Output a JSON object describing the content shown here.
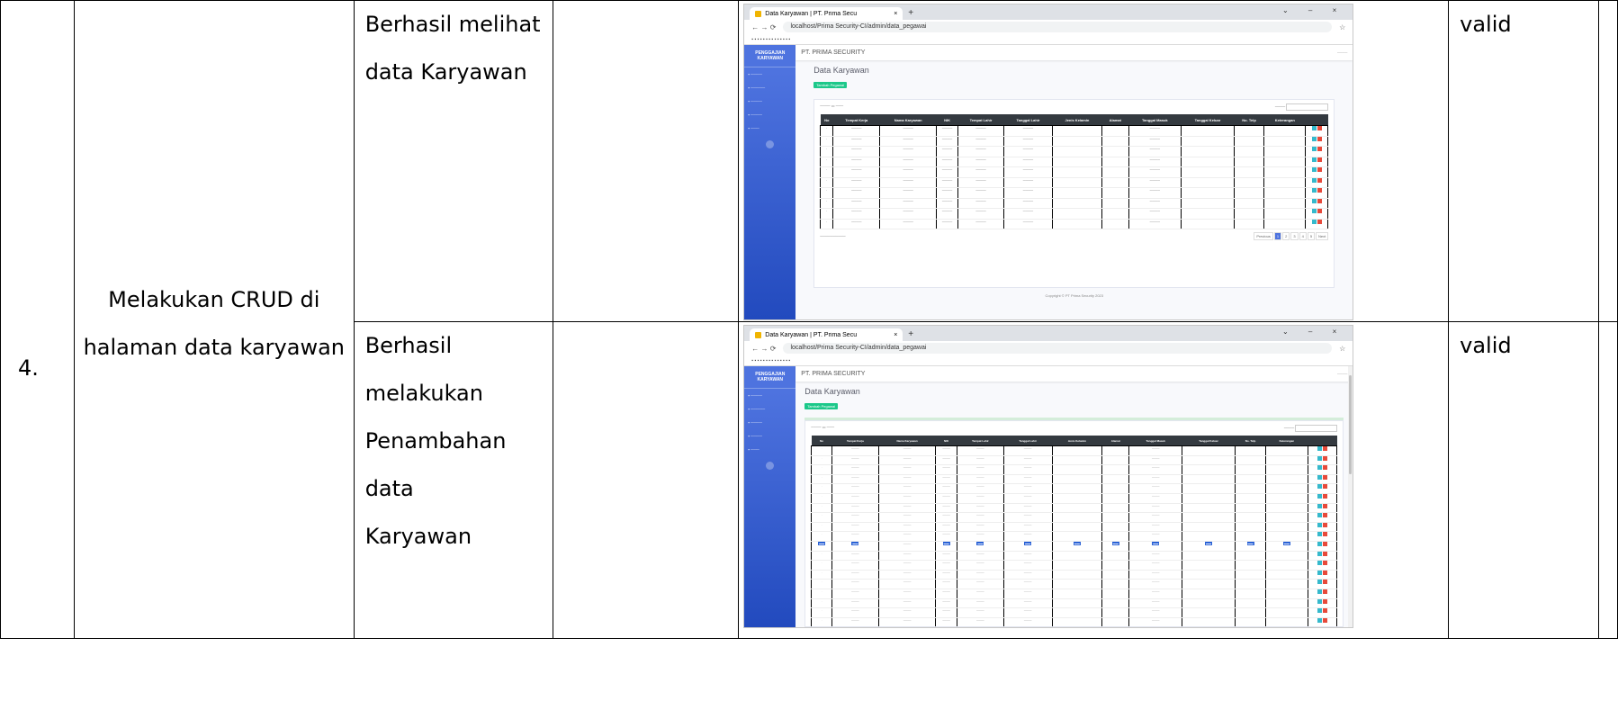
{
  "row_number": "4.",
  "scenario": "Melakukan CRUD di halaman data karyawan",
  "results": [
    {
      "expected": "Berhasil melihat data Karyawan",
      "status": "valid"
    },
    {
      "expected": "Berhasil melakukan Penambahan data Karyawan",
      "status": "valid"
    }
  ],
  "browser": {
    "tab_title": "Data Karyawan | PT. Prima Secu",
    "url": "localhost/Prima Security-CI/admin/data_pegawai"
  },
  "app": {
    "brand": "PENGGAJIAN KARYAWAN",
    "company": "PT. PRIMA SECURITY",
    "page_title": "Data Karyawan",
    "add_button": "Tambah Pegawai",
    "columns": [
      "No",
      "Tempat Kerja",
      "Nama Karyawan",
      "NIK",
      "Tempat Lahir",
      "Tanggal Lahir",
      "Jenis Kelamin",
      "Alamat",
      "Tanggal Masuk",
      "Tanggal Keluar",
      "No. Telp",
      "Keterangan"
    ],
    "next": "Next",
    "previous": "Previous",
    "footer": "Copyright © PT Prima Security 2023"
  }
}
